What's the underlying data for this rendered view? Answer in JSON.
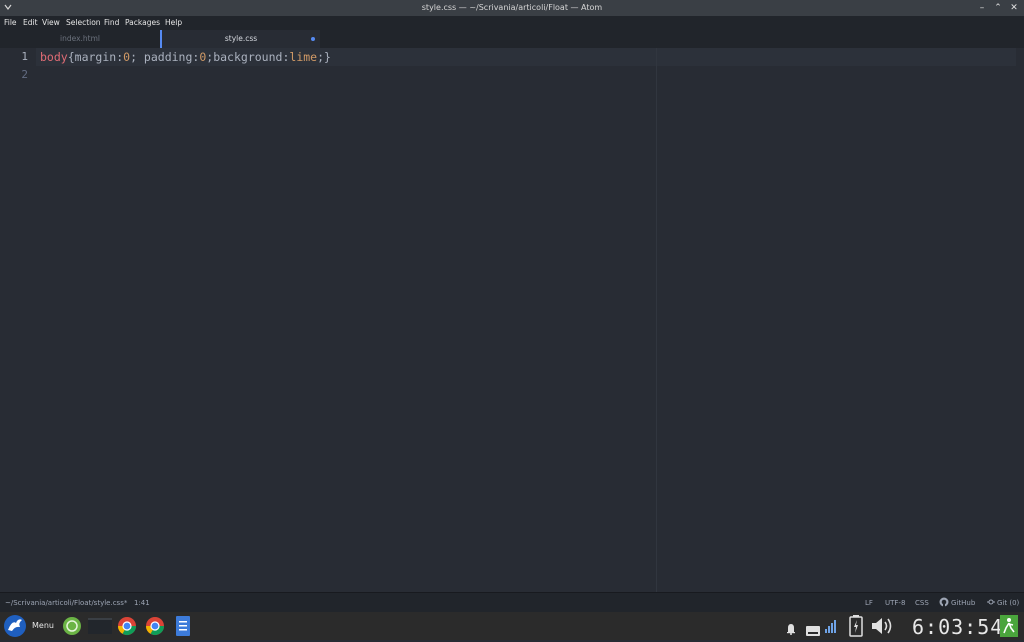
{
  "window": {
    "title": "style.css — ~/Scrivania/articoli/Float — Atom",
    "controls": [
      "minimize-icon",
      "maximize-icon",
      "close-icon"
    ]
  },
  "menubar": {
    "items": [
      "File",
      "Edit",
      "View",
      "Selection",
      "Find",
      "Packages",
      "Help"
    ]
  },
  "tabs": [
    {
      "label": "index.html",
      "active": false
    },
    {
      "label": "style.css",
      "active": true,
      "modified": true
    }
  ],
  "editor": {
    "line_numbers": [
      "1",
      "2"
    ],
    "code": {
      "selector": "body",
      "open_brace": "{",
      "p1_name": "margin",
      "p1_colon": ":",
      "p1_value": "0",
      "p1_semi": "; ",
      "p2_name": "padding",
      "p2_colon": ":",
      "p2_value": "0",
      "p2_semi": ";",
      "p3_name": "background",
      "p3_colon": ":",
      "p3_value": "lime",
      "p3_semi": ";",
      "close_brace": "}"
    },
    "accent_color": "#568af2"
  },
  "statusbar": {
    "file_path": "~/Scrivania/articoli/Float/style.css*",
    "cursor": "1:41",
    "line_ending": "LF",
    "encoding": "UTF-8",
    "grammar": "CSS",
    "github": "GitHub",
    "git": "Git (0)"
  },
  "taskbar": {
    "menu_label": "Menu",
    "clock": "6:03:54",
    "launchers": [
      "mint-icon",
      "window-thumbnail",
      "chrome-icon",
      "chrome-icon",
      "document-icon"
    ],
    "tray": [
      "bell-icon",
      "keyboard-icon",
      "signal-icon",
      "battery-icon",
      "volume-icon",
      "exit-icon"
    ]
  }
}
